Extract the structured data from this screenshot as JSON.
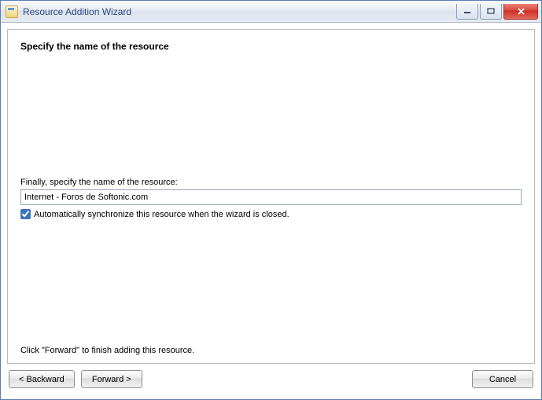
{
  "window": {
    "title": "Resource Addition Wizard"
  },
  "step": {
    "heading": "Specify the name of the resource",
    "field_label": "Finally, specify the name of the resource:",
    "input_value": "Internet - Foros de Softonic.com",
    "checkbox_label": "Automatically synchronize this resource when the wizard is closed.",
    "checkbox_checked": true,
    "hint": "Click \"Forward\" to finish adding this resource."
  },
  "buttons": {
    "backward": "< Backward",
    "forward": "Forward >",
    "cancel": "Cancel"
  }
}
